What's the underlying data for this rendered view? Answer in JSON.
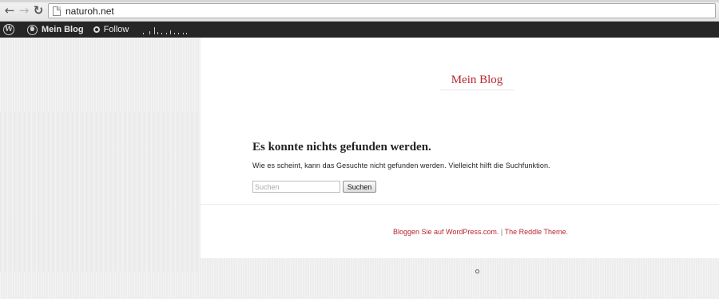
{
  "browser": {
    "back_icon": "arrow-left-icon",
    "forward_icon": "arrow-right-icon",
    "reload_icon": "reload-icon",
    "url": "naturoh.net"
  },
  "admin_bar": {
    "logo_icon": "wordpress-logo-icon",
    "site_link": "Mein Blog",
    "follow_label": "Follow",
    "stats_icon": "stats-sparkline-icon"
  },
  "site": {
    "title": "Mein Blog",
    "title_color": "#b5272d"
  },
  "main": {
    "heading": "Es konnte nichts gefunden werden.",
    "message": "Wie es scheint, kann das Gesuchte nicht gefunden werden. Vielleicht hilft die Suchfunktion.",
    "search": {
      "placeholder": "Suchen",
      "value": "",
      "button_label": "Suchen"
    }
  },
  "footer": {
    "wordpress_link": "Bloggen Sie auf WordPress.com.",
    "separator": " | ",
    "theme_link": "The Reddle Theme."
  }
}
